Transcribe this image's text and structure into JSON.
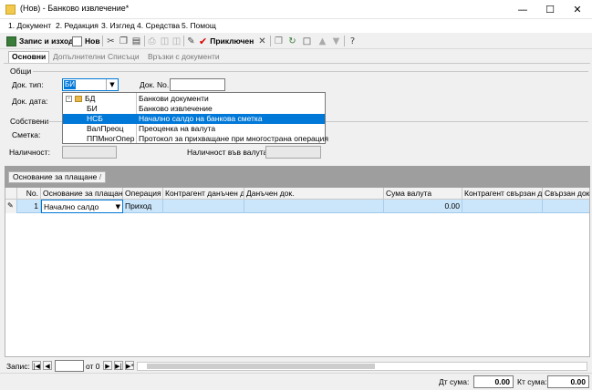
{
  "window": {
    "title": "(Нов) - Банково извлечение*"
  },
  "menu": {
    "items": [
      "1. Документ",
      "2. Редакция",
      "3. Изглед",
      "4. Средства",
      "5. Помощ"
    ]
  },
  "toolbar": {
    "save_exit": "Запис и изход",
    "new": "Нов",
    "posted": "Приключен"
  },
  "tabs": [
    "Основни",
    "Допълнителни",
    "Списъци",
    "Връзки с документи"
  ],
  "general": {
    "group_label": "Общи",
    "doc_type_label": "Док. тип:",
    "doc_type_value": "БИ",
    "doc_no_label": "Док. No.",
    "doc_no_value": "",
    "doc_date_label": "Док. дата:"
  },
  "own": {
    "group_label": "Собствени",
    "account_label": "Сметка:",
    "balance_label": "Наличност:",
    "balance_value": "",
    "balance_currency_label": "Наличност във валута:",
    "balance_currency_value": ""
  },
  "dropdown": {
    "rows": [
      {
        "code": "БД",
        "name": "Банкови документи",
        "selected": false,
        "folder": true
      },
      {
        "code": "БИ",
        "name": "Банково извлечение",
        "selected": false,
        "folder": false
      },
      {
        "code": "НСБ",
        "name": "Начално салдо на банкова сметка",
        "selected": true,
        "folder": false
      },
      {
        "code": "ВалПреоц",
        "name": "Преоценка на валута",
        "selected": false,
        "folder": false
      },
      {
        "code": "ППМногОпер",
        "name": "Протокол за прихващане при многострана операция",
        "selected": false,
        "folder": false
      }
    ]
  },
  "grid": {
    "group_chip": "Основание за плащане",
    "columns": [
      "No.",
      "Основание за плащане",
      "Операция",
      "Контрагент данъчен д...",
      "Данъчен док.",
      "Сума валута",
      "Контрагент свързан д...",
      "Свързан док."
    ],
    "rows": [
      {
        "no": "1",
        "basis": "Начално салдо",
        "operation": "Приход",
        "counterparty": "",
        "tax_doc": "",
        "amount": "0.00",
        "linked_cp": "",
        "linked_doc": ""
      }
    ]
  },
  "navigator": {
    "label": "Запис:",
    "current": "",
    "of_label": "от 0"
  },
  "footer": {
    "dt_label": "Дт сума:",
    "dt_value": "0.00",
    "kt_label": "Кт сума:",
    "kt_value": "0.00"
  },
  "colors": {
    "accent": "#0078d7",
    "row_highlight": "#cbe6fb",
    "group_band": "#9e9e9e"
  }
}
